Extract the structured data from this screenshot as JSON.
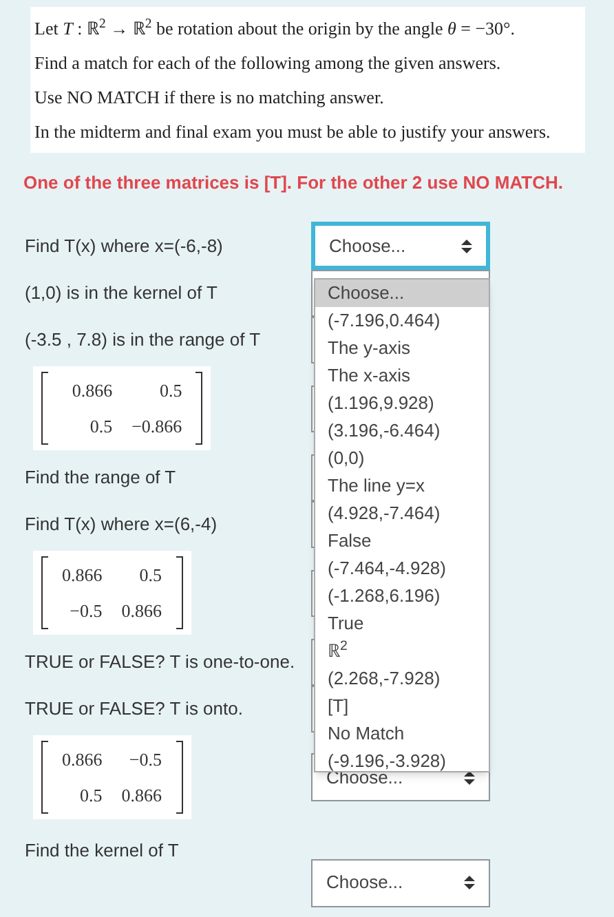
{
  "intro": {
    "lines": [
      "Let *T* : ℝ$^{2}$ → ℝ$^{2}$  be rotation about the origin by the angle *θ* = −30°.",
      "Find a match for each of the following among the given answers.",
      "Use NO MATCH if there is no matching answer.",
      "In the midterm and final exam you must be able to justify your answers."
    ]
  },
  "note": "One of the three matrices is [T]. For the other 2 use NO MATCH.",
  "questions": [
    {
      "kind": "text",
      "label": "Find T(x)  where  x=(-6,-8)",
      "select": {
        "value": "Choose...",
        "focused": true,
        "open": true
      }
    },
    {
      "kind": "text",
      "label": "(1,0) is in the kernel of T"
    },
    {
      "kind": "text",
      "label": "(-3.5 , 7.8)  is in the range of T"
    },
    {
      "kind": "matrix",
      "rows": [
        [
          "0.866",
          "0.5"
        ],
        [
          "0.5",
          "−0.866"
        ]
      ]
    },
    {
      "kind": "text",
      "label": "Find the range of T"
    },
    {
      "kind": "text",
      "label": "Find T(x)  where x=(6,-4)"
    },
    {
      "kind": "matrix",
      "rows": [
        [
          "0.866",
          "0.5"
        ],
        [
          "−0.5",
          "0.866"
        ]
      ]
    },
    {
      "kind": "text",
      "label": "TRUE or FALSE?  T is one-to-one."
    },
    {
      "kind": "text",
      "label": "TRUE or FALSE?  T is onto."
    },
    {
      "kind": "matrix",
      "rows": [
        [
          "0.866",
          "−0.5"
        ],
        [
          "0.5",
          "0.866"
        ]
      ],
      "select": {
        "value": "Choose...",
        "focused": false,
        "open": false
      }
    },
    {
      "kind": "text",
      "label": "Find the kernel of T",
      "select": {
        "value": "Choose...",
        "focused": false,
        "open": false
      }
    }
  ],
  "dropdown": {
    "options": [
      {
        "label": "Choose...",
        "selected": true
      },
      {
        "label": "(-7.196,0.464)",
        "selected": false
      },
      {
        "label": "The y-axis",
        "selected": false
      },
      {
        "label": "The x-axis",
        "selected": false
      },
      {
        "label": "(1.196,9.928)",
        "selected": false
      },
      {
        "label": "(3.196,-6.464)",
        "selected": false
      },
      {
        "label": "(0,0)",
        "selected": false
      },
      {
        "label": "The line y=x",
        "selected": false
      },
      {
        "label": "(4.928,-7.464)",
        "selected": false
      },
      {
        "label": "False",
        "selected": false
      },
      {
        "label": "(-7.464,-4.928)",
        "selected": false
      },
      {
        "label": "(-1.268,6.196)",
        "selected": false
      },
      {
        "label": "True",
        "selected": false
      },
      {
        "label": "ℝ$^{2}$",
        "selected": false
      },
      {
        "label": "(2.268,-7.928)",
        "selected": false
      },
      {
        "label": "[T]",
        "selected": false
      },
      {
        "label": "No Match",
        "selected": false
      },
      {
        "label": "(-9.196,-3.928)",
        "selected": false
      }
    ]
  }
}
